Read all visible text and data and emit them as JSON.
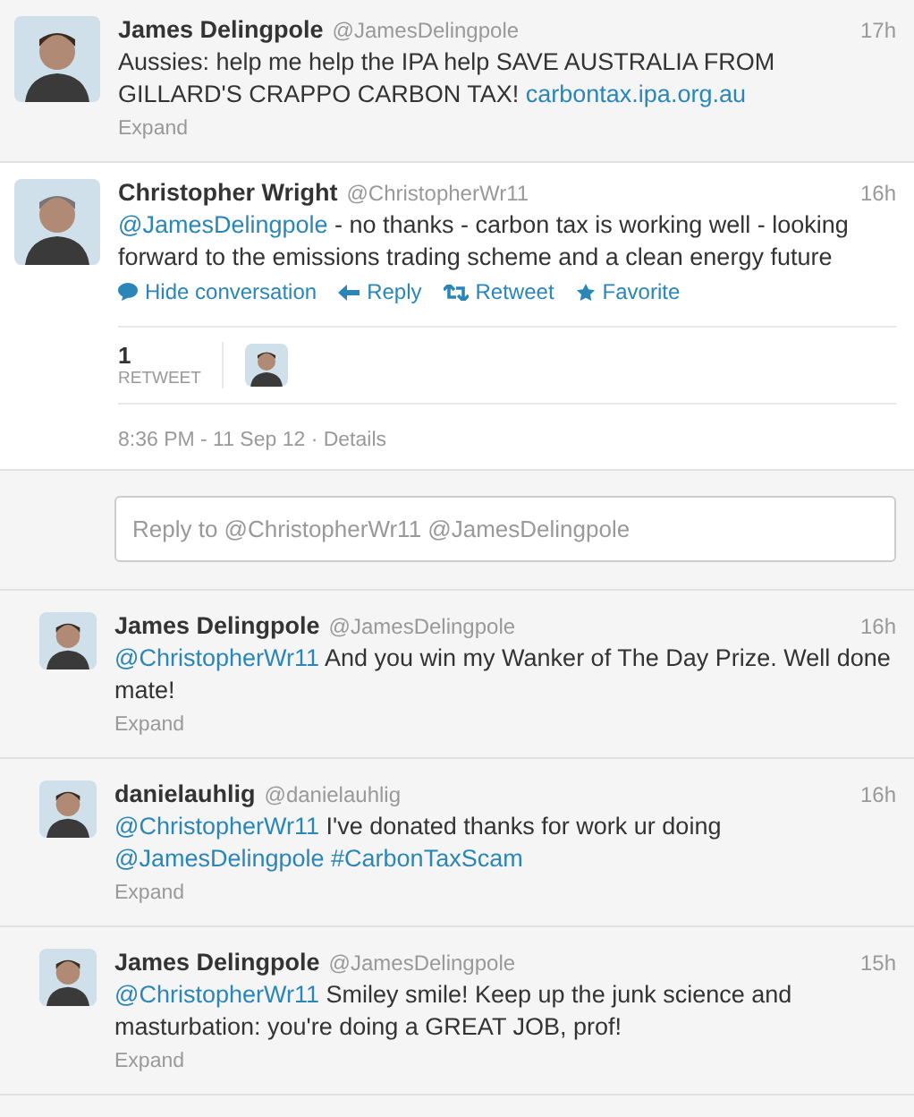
{
  "conversation_above": {
    "name": "James Delingpole",
    "handle": "@JamesDelingpole",
    "time": "17h",
    "text": [
      {
        "kind": "text",
        "text": "Aussies: help me help the IPA help SAVE AUSTRALIA FROM GILLARD'S CRAPPO CARBON TAX! "
      },
      {
        "kind": "url",
        "text": "carbontax.ipa.org.au"
      }
    ],
    "expand": "Expand"
  },
  "focused_tweet": {
    "name": "Christopher Wright",
    "handle": "@ChristopherWr11",
    "time": "16h",
    "text": [
      {
        "kind": "mention",
        "text": "@JamesDelingpole"
      },
      {
        "kind": "text",
        "text": " - no thanks - carbon tax is working well - looking forward to the emissions trading scheme and a clean energy future"
      }
    ],
    "actions": [
      {
        "kind": "conversation",
        "label": "Hide conversation"
      },
      {
        "kind": "reply",
        "label": "Reply"
      },
      {
        "kind": "retweet",
        "label": "Retweet"
      },
      {
        "kind": "favorite",
        "label": "Favorite"
      }
    ],
    "stats": {
      "count": "1",
      "label": "RETWEET"
    },
    "timestamp": "8:36 PM - 11 Sep 12 · Details"
  },
  "reply_box": {
    "placeholder": "Reply to @ChristopherWr11 @JamesDelingpole"
  },
  "replies": [
    {
      "name": "James Delingpole",
      "handle": "@JamesDelingpole",
      "time": "16h",
      "text": [
        {
          "kind": "mention",
          "text": "@ChristopherWr11"
        },
        {
          "kind": "text",
          "text": " And you win my Wanker of The Day Prize. Well done mate!"
        }
      ],
      "expand": "Expand"
    },
    {
      "name": "danielauhlig",
      "handle": "@danielauhlig",
      "time": "16h",
      "text": [
        {
          "kind": "mention",
          "text": "@ChristopherWr11"
        },
        {
          "kind": "text",
          "text": " I've donated thanks for work ur doing "
        },
        {
          "kind": "mention",
          "text": "@JamesDelingpole"
        },
        {
          "kind": "hashtag",
          "text": "#CarbonTaxScam"
        }
      ],
      "expand": "Expand"
    },
    {
      "name": "James Delingpole",
      "handle": "@JamesDelingpole",
      "time": "15h",
      "text": [
        {
          "kind": "mention",
          "text": "@ChristopherWr11"
        },
        {
          "kind": "text",
          "text": " Smiley smile! Keep up the junk science and masturbation: you're doing a GREAT JOB, prof!"
        }
      ],
      "expand": "Expand"
    }
  ]
}
